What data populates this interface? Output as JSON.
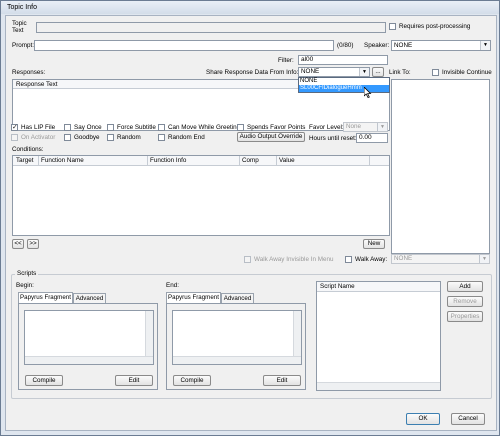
{
  "window": {
    "title": "Topic Info"
  },
  "topic": {
    "label_line1": "Topic",
    "label_line2": "Text",
    "requires_post_processing": "Requires post-processing"
  },
  "prompt": {
    "label": "Prompt:",
    "counter": "(0/80)",
    "speaker_label": "Speaker:",
    "speaker_value": "NONE"
  },
  "filter": {
    "label": "Filter:",
    "value": "al00"
  },
  "responses": {
    "label": "Responses:",
    "share_label": "Share Response Data From Info:",
    "share_value": "NONE",
    "share_options": [
      "NONE",
      "SL00CFIDialogueHmm"
    ],
    "ellipsis": "...",
    "link_to": "Link To:",
    "invisible_continue": "Invisible Continue",
    "column": "Response Text"
  },
  "flags": {
    "has_lip_file": "Has LIP File",
    "say_once": "Say Once",
    "force_subtitle": "Force Subtitle",
    "can_move_while_greeting": "Can Move While Greeting",
    "spends_favor_points": "Spends Favor Points",
    "favor_level_label": "Favor Level:",
    "favor_level_value": "None",
    "on_activator": "On Activator",
    "goodbye": "Goodbye",
    "random": "Random",
    "random_end": "Random End",
    "audio_output_override": "Audio Output Override",
    "hours_until_reset_label": "Hours until reset:",
    "hours_until_reset_value": "0.00"
  },
  "conditions": {
    "label": "Conditions:",
    "columns": [
      "Target",
      "Function Name",
      "Function Info",
      "Comp",
      "Value"
    ],
    "prev": "<<",
    "next": ">>",
    "new": "New"
  },
  "walkaway": {
    "invisible_in_menu": "Walk Away Invisible In Menu",
    "walk_away_label": "Walk Away:",
    "walk_away_value": "NONE"
  },
  "scripts": {
    "group_label": "Scripts",
    "begin_label": "Begin:",
    "end_label": "End:",
    "tab_papyrus": "Papyrus Fragment",
    "tab_advanced": "Advanced",
    "compile": "Compile",
    "edit": "Edit",
    "script_name_col": "Script Name",
    "add": "Add",
    "remove": "Remove",
    "properties": "Properties"
  },
  "footer": {
    "ok": "OK",
    "cancel": "Cancel"
  }
}
